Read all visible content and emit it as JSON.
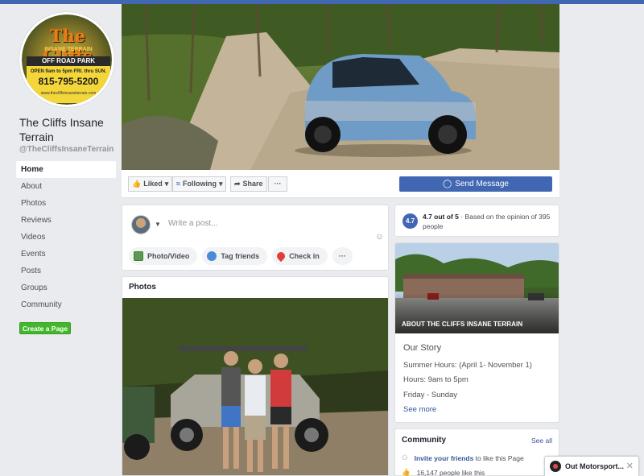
{
  "colors": {
    "brand": "#4267b2",
    "create": "#42b72a",
    "link": "#365899"
  },
  "avatar": {
    "logo_text": "The Cliffs",
    "sub_text": "INSANE TERRAIN",
    "band_text": "OFF ROAD PARK",
    "hours_text": "OPEN 9am to 5pm FRI. thru SUN.",
    "phone_text": "815-795-5200",
    "url_text": "www.thecliffsinsaneterrain.com"
  },
  "page": {
    "name": "The Cliffs Insane Terrain",
    "handle": "@TheCliffsInsaneTerrain"
  },
  "nav": {
    "items": [
      {
        "label": "Home"
      },
      {
        "label": "About"
      },
      {
        "label": "Photos"
      },
      {
        "label": "Reviews"
      },
      {
        "label": "Videos"
      },
      {
        "label": "Events"
      },
      {
        "label": "Posts"
      },
      {
        "label": "Groups"
      },
      {
        "label": "Community"
      }
    ],
    "create_page": "Create a Page"
  },
  "actions": {
    "liked": "Liked",
    "following": "Following",
    "share": "Share",
    "more": "···",
    "send_message": "Send Message"
  },
  "composer": {
    "placeholder": "Write a post...",
    "photo_video": "Photo/Video",
    "tag_friends": "Tag friends",
    "check_in": "Check in",
    "more": "···"
  },
  "photos": {
    "title": "Photos"
  },
  "rating": {
    "score": "4.7",
    "summary": "4.7 out of 5",
    "detail": " · Based on the opinion of 395 people"
  },
  "about": {
    "caption": "ABOUT THE CLIFFS INSANE TERRAIN",
    "story_title": "Our Story",
    "lines": [
      "Summer Hours: (April 1- November 1)",
      "Hours: 9am to 5pm",
      "Friday - Sunday"
    ],
    "see_more": "See more"
  },
  "community": {
    "title": "Community",
    "see_all": "See all",
    "invite_link": "Invite your friends",
    "invite_rest": " to like this Page",
    "likes": "16,147 people like this"
  },
  "chat": {
    "name": "Out Motorsport...",
    "close": "✕"
  }
}
